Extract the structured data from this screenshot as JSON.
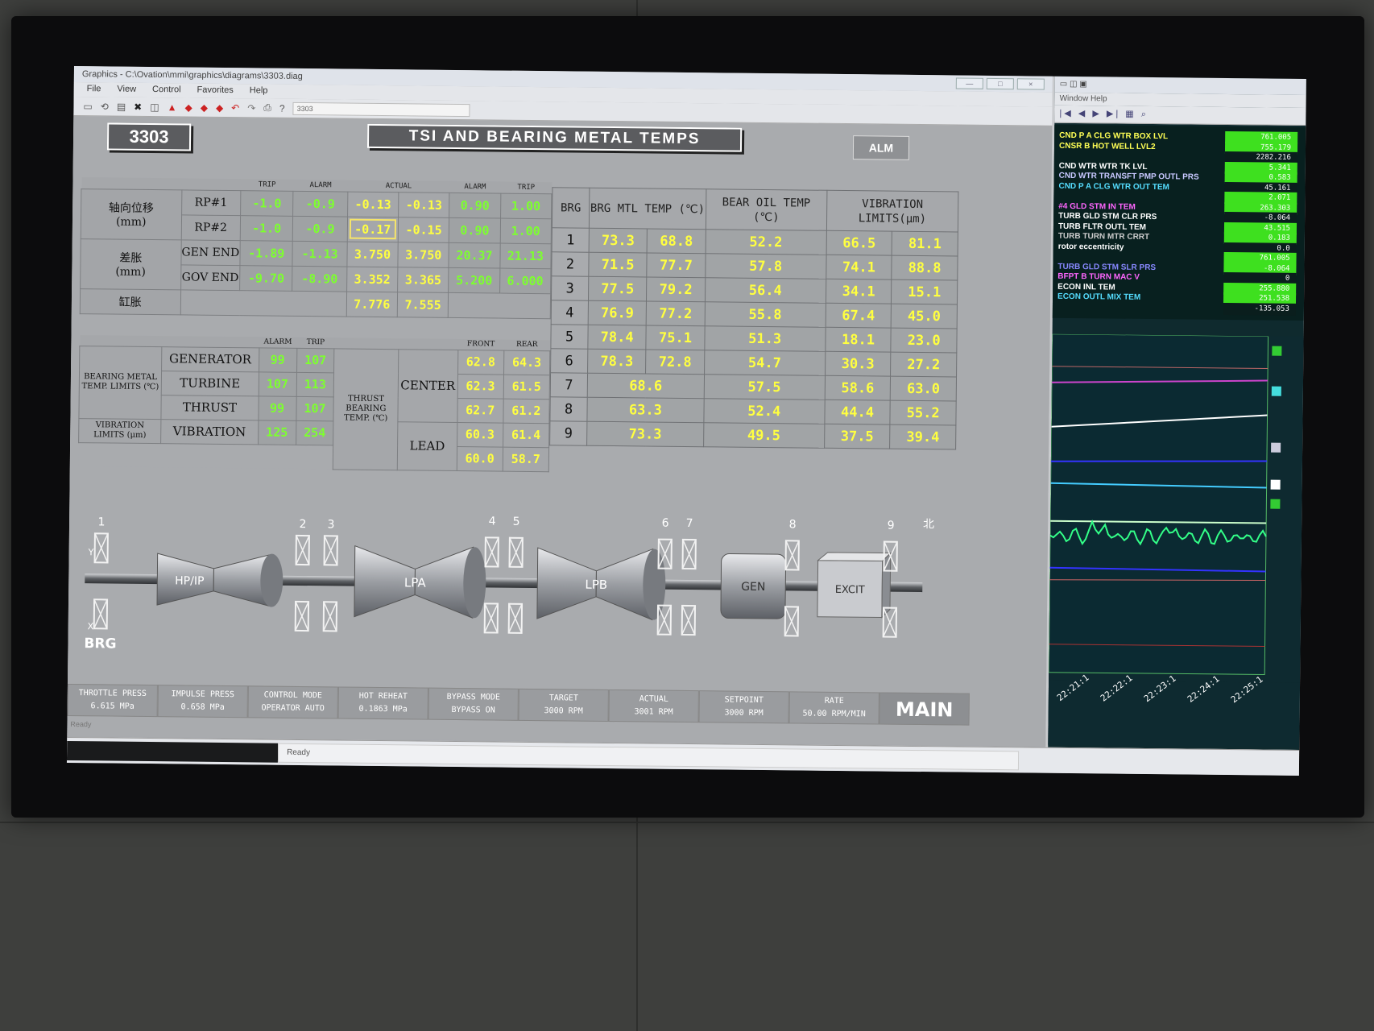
{
  "window": {
    "title": "Graphics - C:\\Ovation\\mmi\\graphics\\diagrams\\3303.diag",
    "menu": [
      "File",
      "View",
      "Control",
      "Favorites",
      "Help"
    ],
    "toolbar_field": "3303"
  },
  "header": {
    "diagram_id": "3303",
    "title": "TSI AND BEARING METAL TEMPS",
    "alarm_button": "ALM"
  },
  "tsi": {
    "col_headers": [
      "TRIP",
      "ALARM",
      "ACTUAL",
      "ALARM",
      "TRIP"
    ],
    "groups": [
      {
        "label_line1": "轴向位移",
        "label_line2": "(mm)"
      },
      {
        "label_line1": "差胀",
        "label_line2": "(mm)"
      }
    ],
    "rows": [
      {
        "name": "RP#1",
        "trip_low": "-1.0",
        "alarm_low": "-0.9",
        "actual_1": "-0.13",
        "actual_2": "-0.13",
        "alarm_high": "0.90",
        "trip_high": "1.00"
      },
      {
        "name": "RP#2",
        "trip_low": "-1.0",
        "alarm_low": "-0.9",
        "actual_1": "-0.17",
        "actual_2": "-0.15",
        "alarm_high": "0.90",
        "trip_high": "1.00"
      },
      {
        "name": "GEN END",
        "trip_low": "-1.89",
        "alarm_low": "-1.13",
        "actual_1": "3.750",
        "actual_2": "3.750",
        "alarm_high": "20.37",
        "trip_high": "21.13"
      },
      {
        "name": "GOV END",
        "trip_low": "-9.70",
        "alarm_low": "-8.90",
        "actual_1": "3.352",
        "actual_2": "3.365",
        "alarm_high": "5.200",
        "trip_high": "6.000"
      }
    ],
    "cylinder": {
      "label": "缸胀",
      "actual_1": "7.776",
      "actual_2": "7.555"
    }
  },
  "limits": {
    "col_headers": [
      "ALARM",
      "TRIP"
    ],
    "bearing_metal_label": "BEARING METAL TEMP. LIMITS (℃)",
    "vibration_label": "VIBRATION LIMITS (μm)",
    "rows": [
      {
        "name": "GENERATOR",
        "alarm": "99",
        "trip": "107"
      },
      {
        "name": "TURBINE",
        "alarm": "107",
        "trip": "113"
      },
      {
        "name": "THRUST",
        "alarm": "99",
        "trip": "107"
      },
      {
        "name": "VIBRATION",
        "alarm": "125",
        "trip": "254"
      }
    ]
  },
  "thrust": {
    "label": "THRUST BEARING TEMP. (℃)",
    "col_headers": [
      "FRONT",
      "REAR"
    ],
    "center_label": "CENTER",
    "lead_label": "LEAD",
    "center": [
      [
        "62.8",
        "64.3"
      ],
      [
        "62.3",
        "61.5"
      ],
      [
        "62.7",
        "61.2"
      ]
    ],
    "lead": [
      [
        "60.3",
        "61.4"
      ],
      [
        "60.0",
        "58.7"
      ]
    ]
  },
  "bearings": {
    "headers": [
      "BRG",
      "BRG MTL TEMP (℃)",
      "BEAR OIL TEMP (℃)",
      "VIBRATION LIMITS(μm)"
    ],
    "rows": [
      {
        "brg": "1",
        "mtl_a": "73.3",
        "mtl_b": "68.8",
        "oil": "52.2",
        "vib_x": "66.5",
        "vib_y": "81.1"
      },
      {
        "brg": "2",
        "mtl_a": "71.5",
        "mtl_b": "77.7",
        "oil": "57.8",
        "vib_x": "74.1",
        "vib_y": "88.8"
      },
      {
        "brg": "3",
        "mtl_a": "77.5",
        "mtl_b": "79.2",
        "oil": "56.4",
        "vib_x": "34.1",
        "vib_y": "15.1"
      },
      {
        "brg": "4",
        "mtl_a": "76.9",
        "mtl_b": "77.2",
        "oil": "55.8",
        "vib_x": "67.4",
        "vib_y": "45.0"
      },
      {
        "brg": "5",
        "mtl_a": "78.4",
        "mtl_b": "75.1",
        "oil": "51.3",
        "vib_x": "18.1",
        "vib_y": "23.0"
      },
      {
        "brg": "6",
        "mtl_a": "78.3",
        "mtl_b": "72.8",
        "oil": "54.7",
        "vib_x": "30.3",
        "vib_y": "27.2"
      },
      {
        "brg": "7",
        "mtl": "68.6",
        "oil": "57.5",
        "vib_x": "58.6",
        "vib_y": "63.0"
      },
      {
        "brg": "8",
        "mtl": "63.3",
        "oil": "52.4",
        "vib_x": "44.4",
        "vib_y": "55.2"
      },
      {
        "brg": "9",
        "mtl": "73.3",
        "oil": "49.5",
        "vib_x": "37.5",
        "vib_y": "39.4"
      }
    ]
  },
  "machine": {
    "sections": [
      "HP/IP",
      "LPA",
      "LPB",
      "GEN",
      "EXCIT"
    ],
    "bearing_numbers": [
      "1",
      "2",
      "3",
      "4",
      "5",
      "6",
      "7",
      "8",
      "9"
    ],
    "brg_label": "BRG",
    "north_label": "北",
    "y_label": "Y",
    "x_label": "X"
  },
  "status": [
    {
      "label": "THROTTLE PRESS",
      "value": "6.615",
      "unit": "MPa"
    },
    {
      "label": "IMPULSE PRESS",
      "value": "0.658",
      "unit": "MPa"
    },
    {
      "label": "CONTROL MODE",
      "value": "OPERATOR AUTO",
      "unit": ""
    },
    {
      "label": "HOT REHEAT",
      "value": "0.1863",
      "unit": "MPa"
    },
    {
      "label": "BYPASS MODE",
      "value": "BYPASS ON",
      "unit": ""
    },
    {
      "label": "TARGET",
      "value": "3000",
      "unit": "RPM"
    },
    {
      "label": "ACTUAL",
      "value": "3001",
      "unit": "RPM"
    },
    {
      "label": "SETPOINT",
      "value": "3000",
      "unit": "RPM"
    },
    {
      "label": "RATE",
      "value": "50.00",
      "unit": "RPM/MIN"
    }
  ],
  "main_button": "MAIN",
  "ready_text": "Ready",
  "right_panel": {
    "menu": "Window  Help",
    "tags": [
      {
        "name": "CND P A CLG WTR BOX LVL",
        "color": "#ffff55",
        "value": "761.005"
      },
      {
        "name": "CNSR B HOT WELL LVL2",
        "color": "#ffff55",
        "value": "755.179"
      },
      {
        "name": "",
        "color": "#ffffff",
        "value": "2282.216"
      },
      {
        "name": "CND WTR WTR TK LVL",
        "color": "#ffffff",
        "value": "5.341"
      },
      {
        "name": "CND WTR TRANSFT PMP OUTL PRS",
        "color": "#c8c8ff",
        "value": "0.583"
      },
      {
        "name": "CND P A CLG WTR OUT TEM",
        "color": "#55ddff",
        "value": "45.161"
      },
      {
        "name": "",
        "color": "#ffffff",
        "value": "2.071"
      },
      {
        "name": "#4 GLD STM IN TEM",
        "color": "#ff66ff",
        "value": "263.303"
      },
      {
        "name": "TURB GLD STM CLR PRS",
        "color": "#ffffff",
        "value": "-8.064"
      },
      {
        "name": "TURB FLTR OUTL TEM",
        "color": "#ffffff",
        "value": "43.515"
      },
      {
        "name": "TURB TURN MTR CRRT",
        "color": "#cccccc",
        "value": "0.183"
      },
      {
        "name": "rotor eccentricity",
        "color": "#ffffff",
        "value": "0.0"
      },
      {
        "name": "",
        "color": "#ffffff",
        "value": "761.005"
      },
      {
        "name": "TURB GLD STM SLR PRS",
        "color": "#8888ff",
        "value": "-8.064"
      },
      {
        "name": "BFPT B TURN MAC V",
        "color": "#ff66ff",
        "value": "0"
      },
      {
        "name": "ECON INL TEM",
        "color": "#ffffff",
        "value": "255.880"
      },
      {
        "name": "ECON OUTL MIX TEM",
        "color": "#55ddff",
        "value": "251.538"
      },
      {
        "name": "",
        "color": "#ffffff",
        "value": "-135.053"
      }
    ],
    "time_labels": [
      "22:21:1",
      "22:22:1",
      "22:23:1",
      "22:24:1",
      "22:25:1"
    ]
  }
}
